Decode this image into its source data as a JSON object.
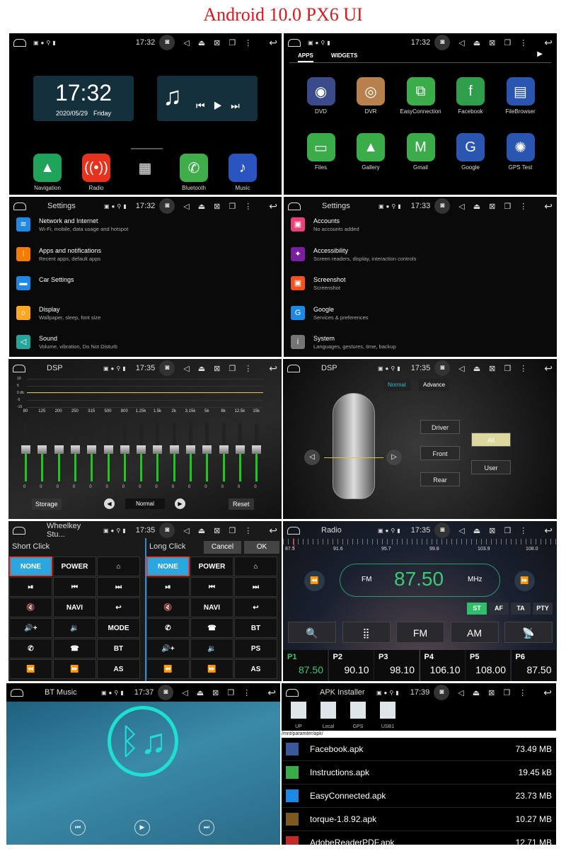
{
  "title": "Android 10.0 PX6 UI",
  "home": {
    "time": "17:32",
    "clock": "17:32",
    "date": "2020/05/29",
    "day": "Friday",
    "dock": [
      {
        "label": "Navigation",
        "color": "#1fa35a",
        "icon": "▲"
      },
      {
        "label": "Radio",
        "color": "#e8321e",
        "icon": "((•))"
      },
      {
        "label": "",
        "color": "transparent",
        "icon": "▦"
      },
      {
        "label": "Bluetooth",
        "color": "#3fae4a",
        "icon": "✆"
      },
      {
        "label": "Music",
        "color": "#2a55c0",
        "icon": "♪"
      }
    ]
  },
  "apps": {
    "time": "17:32",
    "tabs": [
      "APPS",
      "WIDGETS"
    ],
    "items": [
      {
        "label": "DVD",
        "color": "#3a4a8a",
        "icon": "◉"
      },
      {
        "label": "DVR",
        "color": "#b8804c",
        "icon": "◎"
      },
      {
        "label": "EasyConnection",
        "color": "#3aad4a",
        "icon": "⧉"
      },
      {
        "label": "Facebook",
        "color": "#2f9e4a",
        "icon": "f"
      },
      {
        "label": "FileBrowser",
        "color": "#2a55b0",
        "icon": "▤"
      },
      {
        "label": "Files",
        "color": "#3aad4a",
        "icon": "▭"
      },
      {
        "label": "Gallery",
        "color": "#3aad4a",
        "icon": "▲"
      },
      {
        "label": "Gmail",
        "color": "#3aad4a",
        "icon": "M"
      },
      {
        "label": "Google",
        "color": "#2a55b0",
        "icon": "G"
      },
      {
        "label": "GPS Test",
        "color": "#2a55b0",
        "icon": "✺"
      }
    ]
  },
  "settings1": {
    "title": "Settings",
    "time": "17:32",
    "items": [
      {
        "title": "Network and Internet",
        "sub": "Wi-Fi, mobile, data usage and hotspot",
        "color": "#1e88e5",
        "icon": "≋"
      },
      {
        "title": "Apps and notifications",
        "sub": "Recent apps, default apps",
        "color": "#f57c00",
        "icon": "⁞"
      },
      {
        "title": "Car Settings",
        "sub": "",
        "color": "#1e88e5",
        "icon": "▬"
      },
      {
        "title": "Display",
        "sub": "Wallpaper, sleep, font size",
        "color": "#f9a825",
        "icon": "☼"
      },
      {
        "title": "Sound",
        "sub": "Volume, vibration, Do Not Disturb",
        "color": "#26a69a",
        "icon": "◁"
      }
    ]
  },
  "settings2": {
    "title": "Settings",
    "time": "17:33",
    "items": [
      {
        "title": "Accounts",
        "sub": "No accounts added",
        "color": "#ec407a",
        "icon": "▣"
      },
      {
        "title": "Accessibility",
        "sub": "Screen readers, display, interaction controls",
        "color": "#7b1fa2",
        "icon": "✦"
      },
      {
        "title": "Screenshot",
        "sub": "Screenshot",
        "color": "#f4511e",
        "icon": "▣"
      },
      {
        "title": "Google",
        "sub": "Services & preferences",
        "color": "#1e88e5",
        "icon": "G"
      },
      {
        "title": "System",
        "sub": "Languages, gestures, time, backup",
        "color": "#757575",
        "icon": "i"
      }
    ]
  },
  "dsp": {
    "title": "DSP",
    "time": "17:35",
    "db_labels": [
      "10",
      "5",
      "0 db",
      "-5",
      "-10"
    ],
    "bands": [
      "80",
      "125",
      "200",
      "250",
      "315",
      "500",
      "800",
      "1.25k",
      "1.5k",
      "2k",
      "3.15k",
      "5k",
      "8k",
      "12.5k",
      "15k"
    ],
    "values": [
      "0",
      "0",
      "0",
      "0",
      "0",
      "0",
      "0",
      "0",
      "0",
      "0",
      "0",
      "0",
      "0",
      "0",
      "0"
    ],
    "storage": "Storage",
    "preset": "Normal",
    "reset": "Reset"
  },
  "dsp2": {
    "title": "DSP",
    "time": "17:35",
    "tabs": [
      "Normal",
      "Advance"
    ],
    "buttons": [
      "Driver",
      "Front",
      "Rear",
      "User",
      "All"
    ]
  },
  "wheel": {
    "title": "Wheelkey Stu...",
    "time": "17:35",
    "short": "Short Click",
    "long": "Long Click",
    "cancel": "Cancel",
    "ok": "OK",
    "left": [
      "NONE",
      "POWER",
      "⌂",
      "⏯",
      "⏮",
      "⏭",
      "🔇",
      "NAVI",
      "↩",
      "🔊+",
      "🔉",
      "MODE",
      "✆",
      "☎",
      "BT",
      "⏪",
      "⏩",
      "AS"
    ],
    "right": [
      "NONE",
      "POWER",
      "⌂",
      "⏯",
      "⏮",
      "⏭",
      "🔇",
      "NAVI",
      "↩",
      "✆",
      "☎",
      "BT",
      "🔊+",
      "🔉",
      "PS",
      "⏪",
      "⏩",
      "AS"
    ]
  },
  "radio": {
    "title": "Radio",
    "time": "17:35",
    "scale": [
      "87.5",
      "91.6",
      "95.7",
      "99.8",
      "103.9",
      "108.0"
    ],
    "band": "FM",
    "freq": "87.50",
    "unit": "MHz",
    "flags": [
      "ST",
      "AF",
      "TA",
      "PTY"
    ],
    "fm": "FM",
    "am": "AM",
    "presets": [
      {
        "p": "P1",
        "f": "87.50"
      },
      {
        "p": "P2",
        "f": "90.10"
      },
      {
        "p": "P3",
        "f": "98.10"
      },
      {
        "p": "P4",
        "f": "106.10"
      },
      {
        "p": "P5",
        "f": "108.00"
      },
      {
        "p": "P6",
        "f": "87.50"
      }
    ]
  },
  "bt": {
    "title": "BT Music",
    "time": "17:37"
  },
  "apk": {
    "title": "APK Installer",
    "time": "17:39",
    "sources": [
      "UP",
      "Local",
      "GPS",
      "USB1"
    ],
    "path": "/mnt/paramter/apk/",
    "files": [
      {
        "name": "Facebook.apk",
        "size": "73.49 MB"
      },
      {
        "name": "Instructions.apk",
        "size": "19.45 kB"
      },
      {
        "name": "EasyConnected.apk",
        "size": "23.73 MB"
      },
      {
        "name": "torque-1.8.92.apk",
        "size": "10.27 MB"
      },
      {
        "name": "AdobeReaderPDF.apk",
        "size": "12.71 MB"
      }
    ]
  }
}
